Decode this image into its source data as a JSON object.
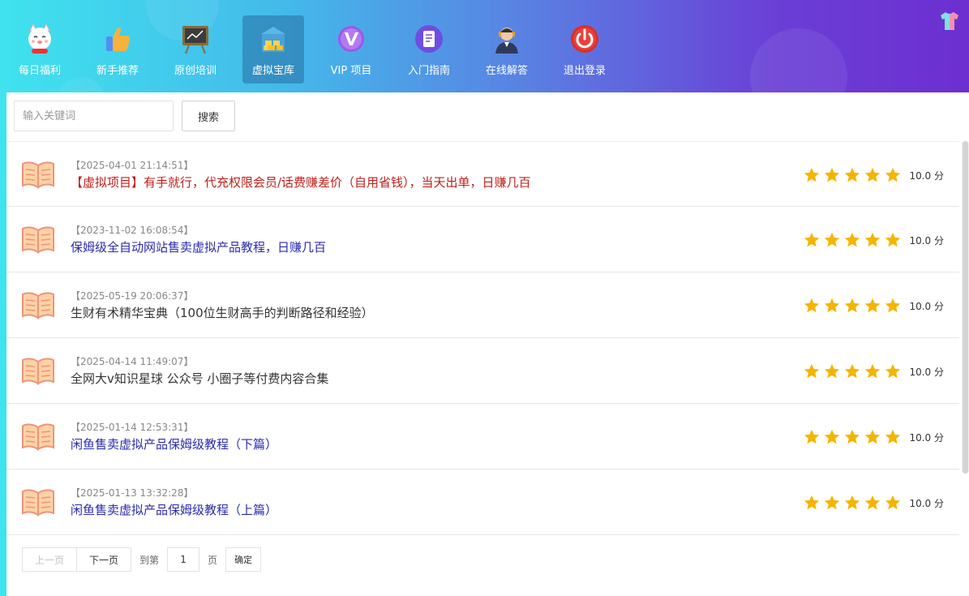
{
  "nav": {
    "items": [
      {
        "label": "每日福利",
        "icon": "lucky-cat-icon"
      },
      {
        "label": "新手推荐",
        "icon": "thumbs-up-icon"
      },
      {
        "label": "原创培训",
        "icon": "chalkboard-icon"
      },
      {
        "label": "虚拟宝库",
        "icon": "treasure-icon",
        "active": true
      },
      {
        "label": "VIP 项目",
        "icon": "vip-icon"
      },
      {
        "label": "入门指南",
        "icon": "guide-icon"
      },
      {
        "label": "在线解答",
        "icon": "support-agent-icon"
      },
      {
        "label": "退出登录",
        "icon": "power-icon"
      }
    ],
    "skin_icon": "tshirt-icon"
  },
  "search": {
    "placeholder": "输入关键词",
    "button_label": "搜索"
  },
  "articles": [
    {
      "date": "【2025-04-01 21:14:51】",
      "title": "【虚拟项目】有手就行，代充权限会员/话费赚差价（自用省钱），当天出单，日赚几百",
      "title_color": "#c0201a",
      "stars": 5,
      "score": "10.0 分"
    },
    {
      "date": "【2023-11-02 16:08:54】",
      "title": "保姆级全自动网站售卖虚拟产品教程，日赚几百",
      "title_color": "#2b2bb0",
      "stars": 5,
      "score": "10.0 分"
    },
    {
      "date": "【2025-05-19 20:06:37】",
      "title": "生财有术精华宝典（100位生财高手的判断路径和经验）",
      "title_color": "#333333",
      "stars": 5,
      "score": "10.0 分"
    },
    {
      "date": "【2025-04-14 11:49:07】",
      "title": "全网大v知识星球 公众号 小圈子等付费内容合集",
      "title_color": "#333333",
      "stars": 5,
      "score": "10.0 分"
    },
    {
      "date": "【2025-01-14 12:53:31】",
      "title": "闲鱼售卖虚拟产品保姆级教程（下篇）",
      "title_color": "#2b2bb0",
      "stars": 5,
      "score": "10.0 分"
    },
    {
      "date": "【2025-01-13 13:32:28】",
      "title": "闲鱼售卖虚拟产品保姆级教程（上篇）",
      "title_color": "#2b2bb0",
      "stars": 5,
      "score": "10.0 分"
    }
  ],
  "pager": {
    "prev_label": "上一页",
    "next_label": "下一页",
    "goto_prefix": "到第",
    "page_value": "1",
    "goto_suffix": "页",
    "confirm_label": "确定"
  },
  "colors": {
    "star": "#f5b400",
    "active_nav_bg": "#2a78a8"
  }
}
